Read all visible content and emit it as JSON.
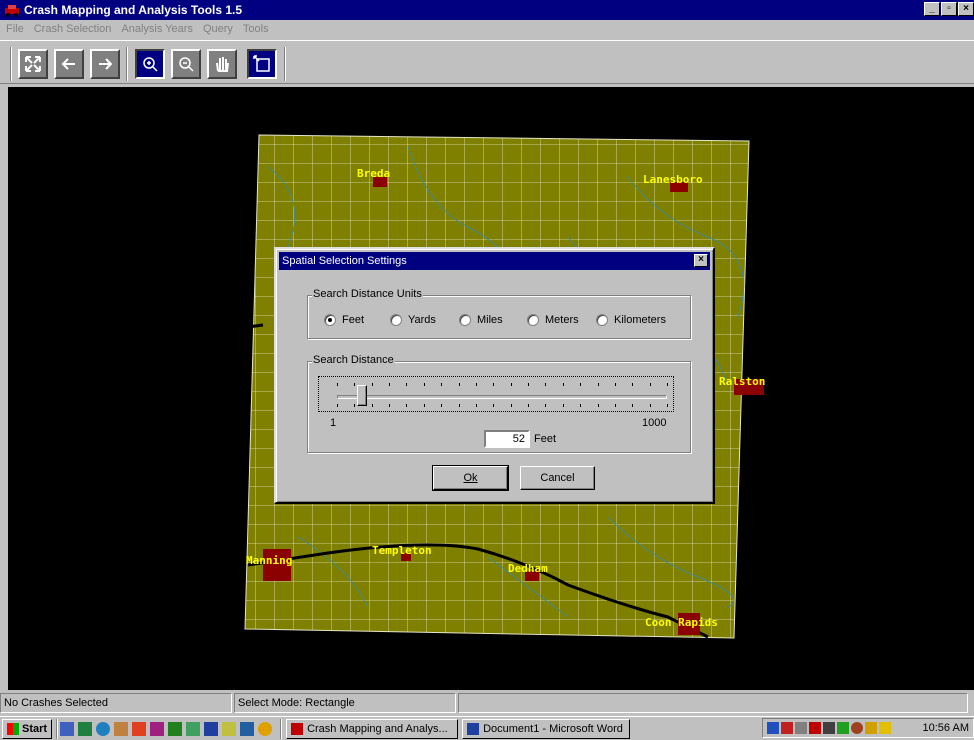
{
  "window": {
    "title": "Crash Mapping and Analysis Tools 1.5"
  },
  "menu": [
    "File",
    "Crash Selection",
    "Analysis Years",
    "Query",
    "Tools"
  ],
  "toolbar": {
    "buttons": [
      "full-extent-icon",
      "back-arrow-icon",
      "forward-arrow-icon",
      "zoom-in-icon",
      "zoom-out-icon",
      "pan-hand-icon",
      "rectangle-select-icon"
    ]
  },
  "map": {
    "colors": {
      "land": "#808000",
      "grid": "#ffffff",
      "road": "#000000",
      "city": "#8b0000",
      "label": "#ffff00",
      "water": "#3c8ca0"
    },
    "cities": [
      "Breda",
      "Lanesboro",
      "Ralston",
      "Manning",
      "Templeton",
      "Dedham",
      "Coon Rapids"
    ]
  },
  "dialog": {
    "title": "Spatial Selection Settings",
    "units_group_label": "Search Distance Units",
    "units": [
      {
        "label": "Feet",
        "checked": true
      },
      {
        "label": "Yards",
        "checked": false
      },
      {
        "label": "Miles",
        "checked": false
      },
      {
        "label": "Meters",
        "checked": false
      },
      {
        "label": "Kilometers",
        "checked": false
      }
    ],
    "distance_group_label": "Search Distance",
    "slider": {
      "min_label": "1",
      "max_label": "1000",
      "value": 52,
      "min": 1,
      "max": 1000
    },
    "distance_value": "52",
    "distance_unit": "Feet",
    "ok_label": "Ok",
    "cancel_label": "Cancel"
  },
  "status": {
    "left": "No Crashes Selected",
    "mode": "Select Mode: Rectangle"
  },
  "taskbar": {
    "start_label": "Start",
    "tasks": [
      "Crash Mapping and Analys...",
      "Document1 - Microsoft Word"
    ],
    "clock": "10:56 AM"
  }
}
